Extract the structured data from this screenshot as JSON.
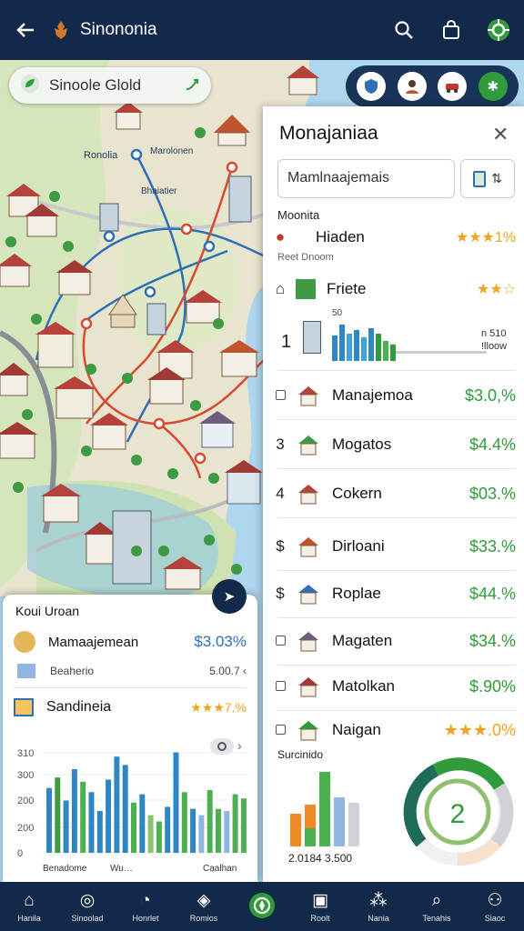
{
  "header": {
    "title": "Sinononia"
  },
  "search": {
    "label": "Sinoole Glold"
  },
  "map": {
    "labels": [
      "Ronolia",
      "Marolonen",
      "Bhaiatier"
    ]
  },
  "panel": {
    "title": "Monajaniaa",
    "input_value": "Mamlnaajemais",
    "section_label": "Moonita",
    "sub_label": "Reet Dnoom",
    "featured": [
      {
        "name": "Hiaden",
        "rating": "★★★1%"
      },
      {
        "name": "Friete",
        "rating": "★★☆"
      }
    ],
    "chart": {
      "rank": "1",
      "y_top": "50",
      "note1": "n 510",
      "note2": "!lloow"
    },
    "rows": [
      {
        "num": "",
        "name": "Manajemoa",
        "value": "$3.0,%"
      },
      {
        "num": "3",
        "name": "Mogatos",
        "value": "$4.4%"
      },
      {
        "num": "4",
        "name": "Cokern",
        "value": "$03.%"
      },
      {
        "num": "$",
        "name": "Dirloani",
        "value": "$33.%"
      },
      {
        "num": "$",
        "name": "Roplae",
        "value": "$44.%"
      },
      {
        "num": "",
        "name": "Magaten",
        "value": "$34.%"
      },
      {
        "num": "",
        "name": "Matolkan",
        "value": "$.90%"
      },
      {
        "num": "",
        "name": "Naigan",
        "value": "★★★.0%"
      }
    ],
    "summary": {
      "title": "Surcinido",
      "caption": "2.0184 3.500",
      "gauge_value": "2"
    }
  },
  "left_card": {
    "title": "Koui Uroan",
    "row1_name": "Mamaajemean",
    "row1_value": "$3.03%",
    "row2_name": "Beaherio",
    "row2_value": "5.00.7 ‹",
    "row3_name": "Sandineia",
    "row3_rating": "★★★7.%",
    "y_ticks": [
      "310",
      "300",
      "200",
      "200",
      "0"
    ],
    "x_labels": [
      "Benadome",
      "Wu…",
      "Caalhan"
    ]
  },
  "nav": [
    {
      "label": "Hanila",
      "icon": "home-icon"
    },
    {
      "label": "Sinoolad",
      "icon": "circle-icon"
    },
    {
      "label": "Honrlet",
      "icon": "chat-icon"
    },
    {
      "label": "Romios",
      "icon": "map-icon"
    },
    {
      "label": "",
      "icon": "center-icon"
    },
    {
      "label": "Roolt",
      "icon": "box-icon"
    },
    {
      "label": "Nania",
      "icon": "network-icon"
    },
    {
      "label": "Tenahis",
      "icon": "search-icon"
    },
    {
      "label": "Siaoc",
      "icon": "profile-icon"
    }
  ],
  "colors": {
    "navy": "#13294a",
    "green": "#2f9b3a",
    "orange": "#f0a322",
    "water": "#aed6ee",
    "land": "#e9e4cf"
  }
}
